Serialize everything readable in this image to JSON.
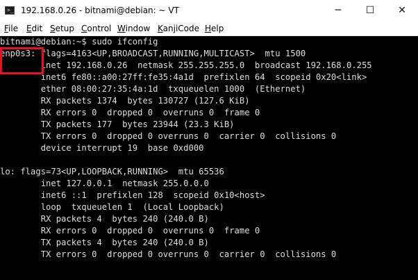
{
  "window": {
    "title": "192.168.0.26 - bitnami@debian: ~ VT",
    "app_icon_glyph": ">_",
    "controls": {
      "minimize": "─",
      "maximize": "☐",
      "close": "✕"
    }
  },
  "menu": [
    {
      "accel": "F",
      "rest": "ile"
    },
    {
      "accel": "E",
      "rest": "dit"
    },
    {
      "accel": "S",
      "rest": "etup"
    },
    {
      "accel": "C",
      "rest": "ontrol"
    },
    {
      "accel": "W",
      "rest": "indow"
    },
    {
      "accel": "K",
      "rest": "anjiCode"
    },
    {
      "accel": "H",
      "rest": "elp"
    }
  ],
  "terminal": {
    "text_color": "#dedede",
    "background": "#000000",
    "lines": [
      "bitnami@debian:~$ sudo ifconfig",
      "enp0s3: flags=4163<UP,BROADCAST,RUNNING,MULTICAST>  mtu 1500",
      "        inet 192.168.0.26  netmask 255.255.255.0  broadcast 192.168.0.255",
      "        inet6 fe80::a00:27ff:fe35:4a1d  prefixlen 64  scopeid 0x20<link>",
      "        ether 08:00:27:35:4a:1d  txqueuelen 1000  (Ethernet)",
      "        RX packets 1374  bytes 130727 (127.6 KiB)",
      "        RX errors 0  dropped 0  overruns 0  frame 0",
      "        TX packets 177  bytes 23944 (23.3 KiB)",
      "        TX errors 0  dropped 0 overruns 0  carrier 0  collisions 0",
      "        device interrupt 19  base 0xd000",
      "",
      "lo: flags=73<UP,LOOPBACK,RUNNING>  mtu 65536",
      "        inet 127.0.0.1  netmask 255.0.0.0",
      "        inet6 ::1  prefixlen 128  scopeid 0x10<host>",
      "        loop  txqueuelen 1  (Local Loopback)",
      "        RX packets 4  bytes 240 (240.0 B)",
      "        RX errors 0  dropped 0  overruns 0  frame 0",
      "        TX packets 4  bytes 240 (240.0 B)",
      "        TX errors 0  dropped 0 overruns 0  carrier 0  collisions 0"
    ]
  },
  "annotation": {
    "color": "#e81123"
  }
}
